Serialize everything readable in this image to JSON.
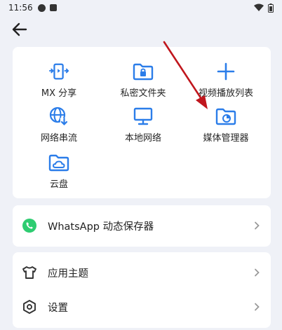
{
  "status_bar": {
    "time": "11:56"
  },
  "grid_items": [
    {
      "label": "MX 分享",
      "icon": "mx-share-icon"
    },
    {
      "label": "私密文件夹",
      "icon": "private-folder-icon"
    },
    {
      "label": "视频播放列表",
      "icon": "plus-icon"
    },
    {
      "label": "网络串流",
      "icon": "network-stream-icon"
    },
    {
      "label": "本地网络",
      "icon": "monitor-icon"
    },
    {
      "label": "媒体管理器",
      "icon": "media-manager-icon"
    },
    {
      "label": "云盘",
      "icon": "cloud-folder-icon"
    }
  ],
  "whatsapp_row": {
    "label": "WhatsApp 动态保存器",
    "icon": "whatsapp-icon",
    "color": "#2ecc71"
  },
  "settings_rows": [
    {
      "label": "应用主题",
      "icon": "tshirt-icon"
    },
    {
      "label": "设置",
      "icon": "hexagon-settings-icon"
    }
  ],
  "colors": {
    "accent": "#2b7de9",
    "background": "#eff1f7",
    "card": "#ffffff",
    "annotation": "#c0161d"
  }
}
